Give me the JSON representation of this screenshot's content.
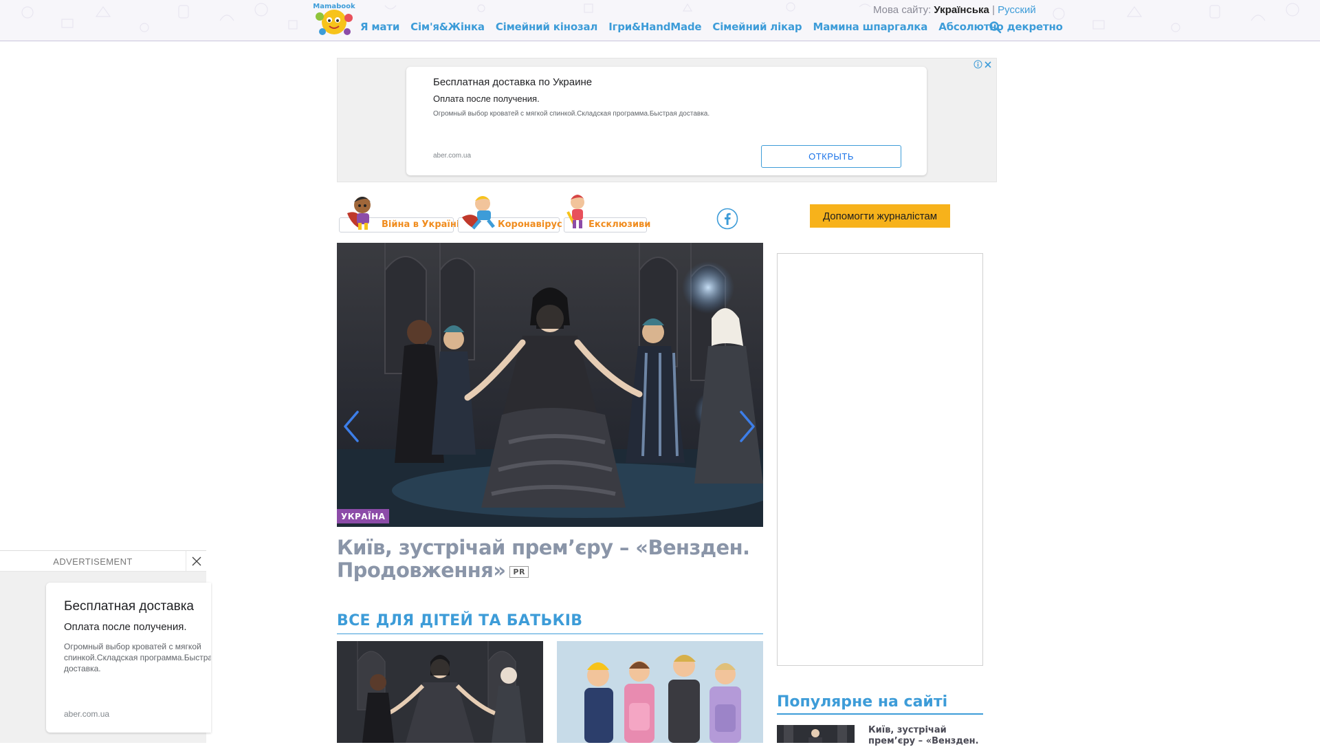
{
  "header": {
    "logo_text": "Mamabook",
    "lang_label": "Мова сайту:",
    "lang_current": "Українська",
    "lang_separator": "|",
    "lang_other": "Русский",
    "nav": [
      "Я мати",
      "Сім'я&Жінка",
      "Сімейний кінозал",
      "Ігри&HandMade",
      "Сімейний лікар",
      "Мамина шпаргалка",
      "Абсолютно декретно"
    ],
    "search_icon": "search-icon"
  },
  "top_ad": {
    "title": "Бесплатная доставка по Украине",
    "subtitle": "Оплата после получения.",
    "description": "Огромный выбор кроватей с мягкой спинкой.Складская программа.Быстрая доставка.",
    "domain": "aber.com.ua",
    "button": "ОТКРЫТЬ",
    "icons": [
      "adchoices-icon",
      "close-icon"
    ]
  },
  "categories": [
    {
      "label": "Війна в Україні",
      "icon": "superhero-girl-icon"
    },
    {
      "label": "Коронавірус",
      "icon": "superhero-boy-icon"
    },
    {
      "label": "Ексклюзиви",
      "icon": "superhero-kid-icon"
    }
  ],
  "social": {
    "icon": "facebook-icon"
  },
  "help_button": "Допомогти журналістам",
  "hero": {
    "badge": "УКРАЇНА",
    "title": "Київ, зустрічай прем’єру – «Вензден. Продовження»",
    "tag": "PR",
    "prev_icon": "chevron-left-icon",
    "next_icon": "chevron-right-icon"
  },
  "section": {
    "title": "ВСЕ ДЛЯ ДІТЕЙ ТА БАТЬКІВ"
  },
  "popular": {
    "title": "Популярне на сайті",
    "items": [
      {
        "title": "Київ, зустрічай прем’єру – «Вензден."
      }
    ]
  },
  "sticky_ad": {
    "label": "ADVERTISEMENT",
    "title": "Бесплатная доставка",
    "subtitle": "Оплата после получения.",
    "description": "Огромный выбор кроватей с мягкой спинкой.Складская программа.Быстрая доставка.",
    "domain": "aber.com.ua",
    "close_icon": "close-icon"
  },
  "colors": {
    "accent_blue": "#3d9cd8",
    "category_orange": "#f08c1e",
    "badge_purple": "#8c4ca8",
    "help_yellow": "#f7b21b",
    "title_gray": "#8a95a8"
  }
}
